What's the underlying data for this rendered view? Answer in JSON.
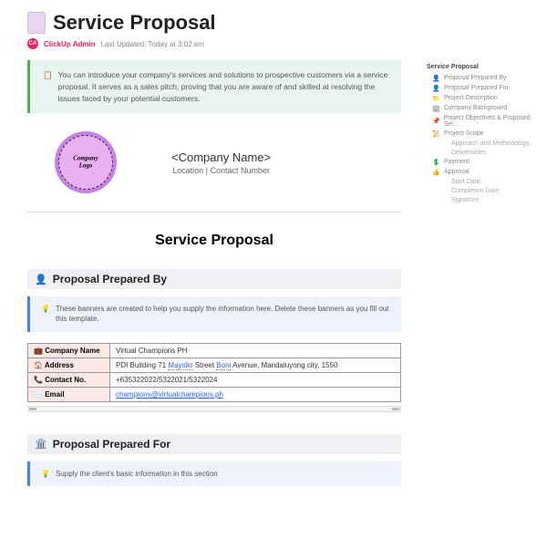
{
  "header": {
    "title": "Service Proposal",
    "author": "ClickUp Admin",
    "author_initials": "CA",
    "updated": "Last Updated: Today at 3:02 am"
  },
  "intro": {
    "text": "You can introduce your company's services and solutions to prospective customers via a service proposal. It serves as a sales pitch, proving that you are aware of and skilled at resolving the issues faced by your potential customers."
  },
  "logo": {
    "line1": "Company",
    "line2": "Logo"
  },
  "company": {
    "name": "<Company Name>",
    "location": "Location | Contact Number"
  },
  "doc_title": "Service Proposal",
  "sections": {
    "prepared_by": {
      "heading": "Proposal Prepared By",
      "tip": "These banners are created to help you supply the information here. Delete these banners as you fill out this template.",
      "rows": {
        "company": {
          "label": "Company Name",
          "value": "Virtual Champions PH"
        },
        "address": {
          "label": "Address",
          "value_pre": "PDI Building 71 ",
          "value_link": "Mayslio",
          "value_mid": " Street ",
          "value_link2": "Boni",
          "value_post": " Avenue, Mandaluyong city, 1550"
        },
        "contact": {
          "label": "Contact No.",
          "value": "+635322022/5322021/5322024"
        },
        "email": {
          "label": "Email",
          "value": "champions@virtualchampions.ph"
        }
      }
    },
    "prepared_for": {
      "heading": "Proposal Prepared For",
      "tip": "Supply the client's basic information in this section"
    }
  },
  "outline": {
    "title": "Service Proposal",
    "items": [
      {
        "icon": "👤",
        "label": "Proposal Prepared By"
      },
      {
        "icon": "👤",
        "label": "Proposal Prepared For"
      },
      {
        "icon": "📁",
        "label": "Project Description"
      },
      {
        "icon": "🏢",
        "label": "Company Background"
      },
      {
        "icon": "📌",
        "label": "Project Objectives & Proposed Ser..."
      },
      {
        "icon": "📜",
        "label": "Project Scope"
      },
      {
        "icon": "",
        "label": "Approach and Methodology",
        "sub": true
      },
      {
        "icon": "",
        "label": "Deliverables",
        "sub": true
      },
      {
        "icon": "💲",
        "label": "Payment"
      },
      {
        "icon": "👍",
        "label": "Approval"
      },
      {
        "icon": "",
        "label": "Start Date:",
        "sub": true
      },
      {
        "icon": "",
        "label": "Completion Date:",
        "sub": true
      },
      {
        "icon": "",
        "label": "Signature:",
        "sub": true
      }
    ]
  }
}
